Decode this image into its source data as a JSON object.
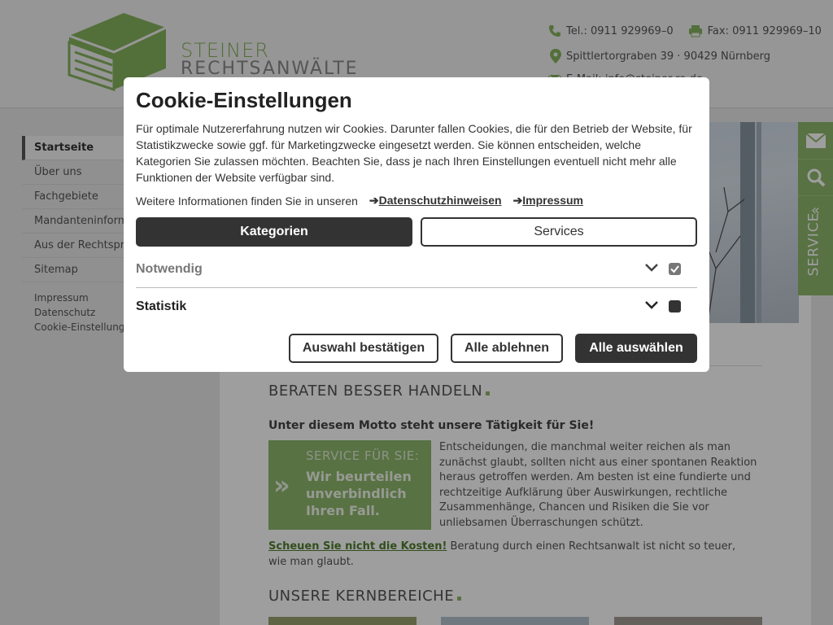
{
  "header": {
    "logo_line1": "STEINER",
    "logo_line2": "RECHTSANWÄLTE",
    "phone": "Tel.: 0911 929969–0",
    "fax": "Fax: 0911 929969–10",
    "address": "Spittlertorgraben 39 · 90429 Nürnberg",
    "email_partial": "E-Mail: info@steiner-ra.de"
  },
  "sidebar": {
    "items": [
      {
        "label": "Startseite"
      },
      {
        "label": "Über uns"
      },
      {
        "label": "Fachgebiete"
      },
      {
        "label": "Mandanteninformationen"
      },
      {
        "label": "Aus der Rechtsprechung"
      },
      {
        "label": "Sitemap"
      }
    ],
    "footer_links": [
      "Impressum",
      "Datenschutz",
      "Cookie-Einstellungen"
    ]
  },
  "service_tab": {
    "label": "SERVICE"
  },
  "content": {
    "heading1": "BERATEN BESSER HANDELN",
    "motto": "Unter diesem Motto steht unsere Tätigkeit für Sie!",
    "service_box_title": "SERVICE FÜR SIE:",
    "service_box_text": "Wir beurteilen unverbindlich Ihren Fall.",
    "description": "Entscheidungen, die manchmal weiter reichen als man zunächst glaubt, sollten nicht aus einer spontanen Reaktion heraus getroffen werden. Am besten ist eine fundierte und rechtzeitige Aufklärung über Auswirkungen, rechtliche Zusammenhänge, Chancen und Risiken die Sie vor unliebsamen Überraschungen schützt.",
    "costs_link": "Scheuen Sie nicht die Kosten!",
    "costs_text": " Beratung durch einen Rechtsanwalt ist nicht so teuer, wie man glaubt.",
    "heading2": "UNSERE KERNBEREICHE"
  },
  "cookie_modal": {
    "title": "Cookie-Einstellungen",
    "intro": "Für optimale Nutzererfahrung nutzen wir Cookies. Darunter fallen Cookies, die für den Betrieb der Website, für Statistikzwecke sowie ggf. für Marketingzwecke eingesetzt werden. Sie können entscheiden, welche Kategorien Sie zulassen möchten. Beachten Sie, dass je nach Ihren Einstellungen eventuell nicht mehr alle Funktionen der Website verfügbar sind.",
    "more_info": "Weitere Informationen finden Sie in unseren",
    "link_privacy": "Datenschutzhinweisen",
    "link_imprint": "Impressum",
    "tab_categories": "Kategorien",
    "tab_services": "Services",
    "categories": [
      {
        "label": "Notwendig",
        "checked": true,
        "locked": true
      },
      {
        "label": "Statistik",
        "checked": false,
        "locked": false
      }
    ],
    "btn_confirm": "Auswahl bestätigen",
    "btn_reject": "Alle ablehnen",
    "btn_accept": "Alle auswählen"
  },
  "colors": {
    "brand_green": "#8fb96c",
    "dark": "#333333"
  }
}
